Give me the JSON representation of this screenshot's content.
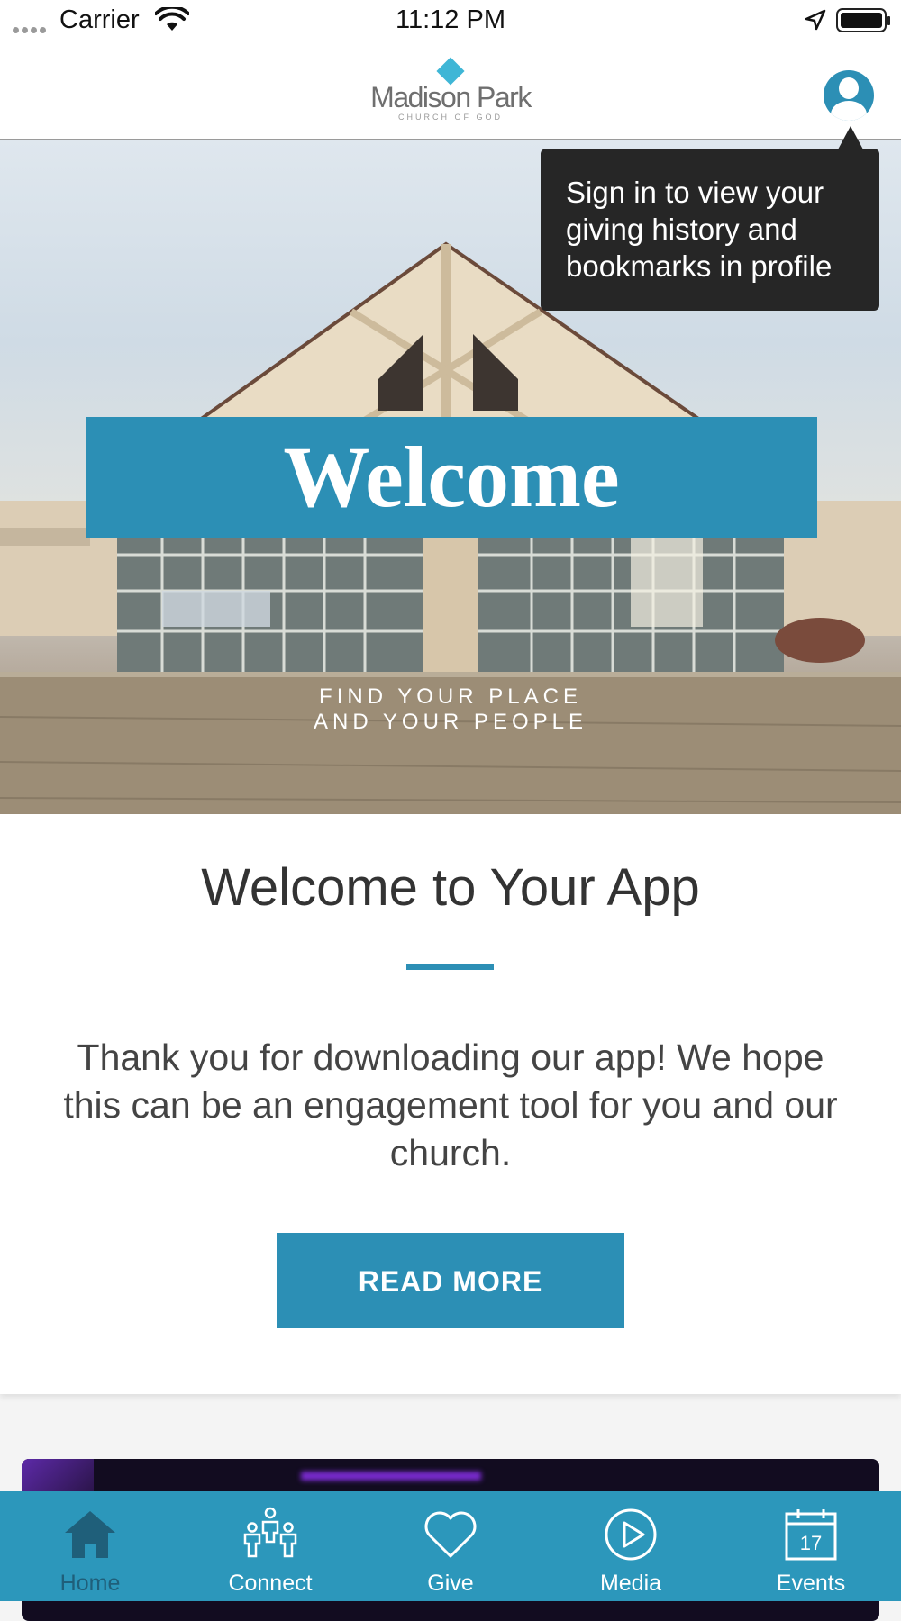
{
  "status_bar": {
    "carrier": "Carrier",
    "time": "11:12 PM"
  },
  "header": {
    "logo_name": "Madison Park",
    "logo_sub": "CHURCH OF GOD"
  },
  "tooltip": {
    "text": "Sign in to view your giving history and bookmarks in profile"
  },
  "hero": {
    "banner": "Welcome",
    "tagline_line1": "FIND YOUR PLACE",
    "tagline_line2": "AND YOUR PEOPLE"
  },
  "content": {
    "title": "Welcome to Your App",
    "body": "Thank you for downloading our app! We hope this can be an engagement tool for you and our church.",
    "button": "READ MORE"
  },
  "tabs": [
    {
      "label": "Home",
      "icon": "home-icon",
      "active": true
    },
    {
      "label": "Connect",
      "icon": "people-icon",
      "active": false
    },
    {
      "label": "Give",
      "icon": "heart-icon",
      "active": false
    },
    {
      "label": "Media",
      "icon": "play-icon",
      "active": false
    },
    {
      "label": "Events",
      "icon": "calendar-icon",
      "active": false,
      "badge": "17"
    }
  ],
  "colors": {
    "accent": "#2c8fb5",
    "tab_bar": "#2c97bb",
    "tooltip": "#262626"
  }
}
